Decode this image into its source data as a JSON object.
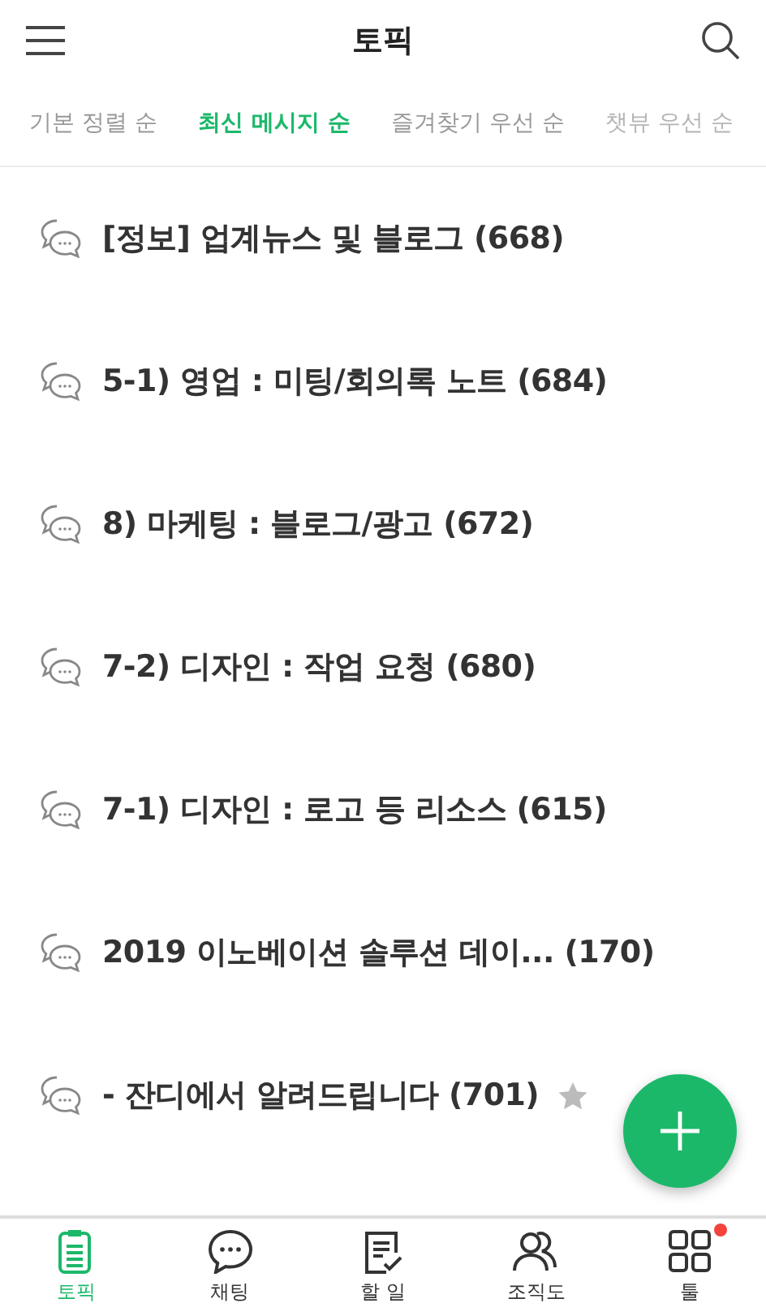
{
  "header": {
    "title": "토픽"
  },
  "sort_tabs": [
    {
      "label": "기본 정렬 순",
      "selected": false
    },
    {
      "label": "최신 메시지 순",
      "selected": true
    },
    {
      "label": "즐겨찾기 우선 순",
      "selected": false
    },
    {
      "label": "챗뷰 우선 순",
      "selected": false
    }
  ],
  "topics": [
    {
      "name": "[정보] 업계뉴스 및 블로그 (668)",
      "favorite": false
    },
    {
      "name": "5-1) 영업 : 미팅/회의록 노트 (684)",
      "favorite": false
    },
    {
      "name": "8) 마케팅 : 블로그/광고 (672)",
      "favorite": false
    },
    {
      "name": "7-2) 디자인 : 작업 요청 (680)",
      "favorite": false
    },
    {
      "name": "7-1) 디자인 : 로고 등 리소스 (615)",
      "favorite": false
    },
    {
      "name": "2019 이노베이션 솔루션 데이... (170)",
      "favorite": false
    },
    {
      "name": "- 잔디에서 알려드립니다 (701)",
      "favorite": true
    }
  ],
  "bottom_nav": [
    {
      "kind": "topic",
      "label": "토픽",
      "selected": true,
      "badge": false
    },
    {
      "kind": "chat",
      "label": "채팅",
      "selected": false,
      "badge": false
    },
    {
      "kind": "todo",
      "label": "할 일",
      "selected": false,
      "badge": false
    },
    {
      "kind": "org",
      "label": "조직도",
      "selected": false,
      "badge": false
    },
    {
      "kind": "tools",
      "label": "툴",
      "selected": false,
      "badge": true
    }
  ]
}
